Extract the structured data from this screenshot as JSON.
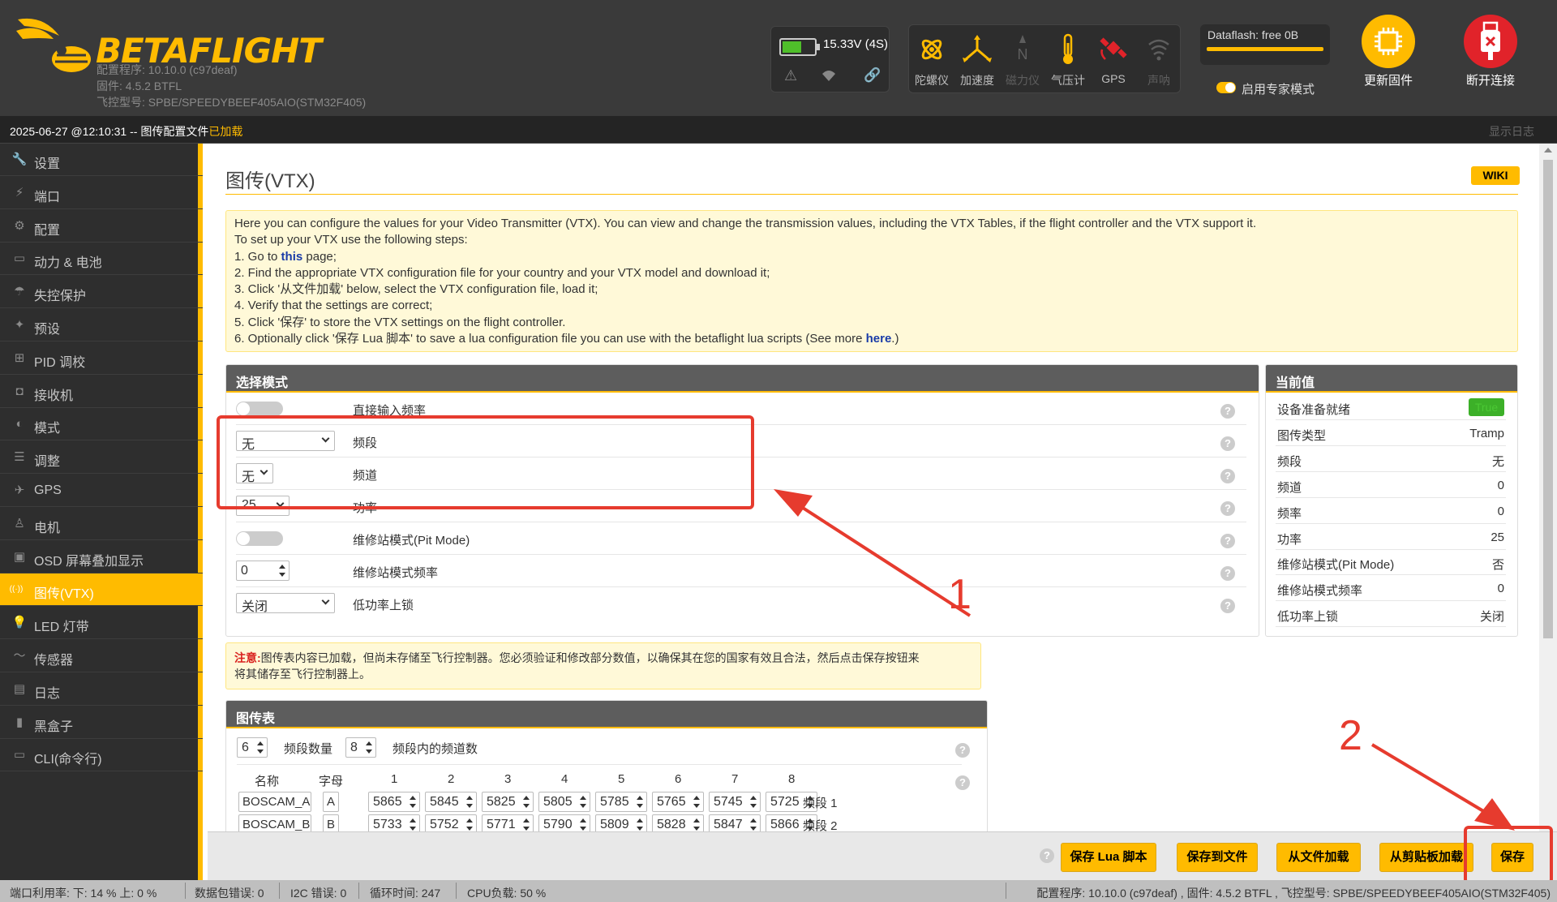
{
  "header": {
    "brand": "BETAFLIGHT",
    "configurator": "配置程序: 10.10.0 (c97deaf)",
    "firmware": "固件: 4.5.2 BTFL",
    "board": "飞控型号: SPBE/SPEEDYBEEF405AIO(STM32F405)",
    "battery": {
      "voltage": "15.33V (4S)",
      "level": 0.55,
      "fill_color": "#4fbf2a"
    },
    "sensors": [
      {
        "label": "陀螺仪",
        "icon": "gyro-icon",
        "active": true
      },
      {
        "label": "加速度",
        "icon": "accel-icon",
        "active": true
      },
      {
        "label": "磁力仪",
        "icon": "compass-icon",
        "active": false
      },
      {
        "label": "气压计",
        "icon": "baro-icon",
        "active": true
      },
      {
        "label": "GPS",
        "icon": "gps-icon",
        "active": true
      },
      {
        "label": "声呐",
        "icon": "sonar-icon",
        "active": false
      }
    ],
    "dataflash": "Dataflash: free 0B",
    "expert_mode": "启用专家模式",
    "update_firmware": "更新固件",
    "disconnect": "断开连接",
    "accent": "#ffbb00",
    "disconnect_color": "#e1232a"
  },
  "logbar": {
    "prefix": "2025-06-27 @12:10:31 -- 图传配置文件",
    "loaded": "已加载",
    "show_log": "显示日志"
  },
  "sidebar": {
    "items": [
      {
        "label": "设置",
        "icon": "wrench-icon",
        "active": false
      },
      {
        "label": "端口",
        "icon": "plug-icon",
        "active": false
      },
      {
        "label": "配置",
        "icon": "gear-icon",
        "active": false
      },
      {
        "label": "动力 & 电池",
        "icon": "battery-icon",
        "active": false
      },
      {
        "label": "失控保护",
        "icon": "parachute-icon",
        "active": false
      },
      {
        "label": "预设",
        "icon": "wand-icon",
        "active": false
      },
      {
        "label": "PID 调校",
        "icon": "sitemap-icon",
        "active": false
      },
      {
        "label": "接收机",
        "icon": "receiver-icon",
        "active": false
      },
      {
        "label": "模式",
        "icon": "toggle-icon",
        "active": false
      },
      {
        "label": "调整",
        "icon": "sliders-icon",
        "active": false
      },
      {
        "label": "GPS",
        "icon": "satellite-icon",
        "active": false
      },
      {
        "label": "电机",
        "icon": "motor-icon",
        "active": false
      },
      {
        "label": "OSD 屏幕叠加显示",
        "icon": "osd-icon",
        "active": false
      },
      {
        "label": "图传(VTX)",
        "icon": "broadcast-icon",
        "active": true
      },
      {
        "label": "LED 灯带",
        "icon": "led-icon",
        "active": false
      },
      {
        "label": "传感器",
        "icon": "pulse-icon",
        "active": false
      },
      {
        "label": "日志",
        "icon": "log-icon",
        "active": false
      },
      {
        "label": "黑盒子",
        "icon": "blackbox-icon",
        "active": false
      },
      {
        "label": "CLI(命令行)",
        "icon": "terminal-icon",
        "active": false
      }
    ]
  },
  "main": {
    "title": "图传(VTX)",
    "wiki": "WIKI",
    "note": {
      "l1": "Here you can configure the values for your Video Transmitter (VTX). You can view and change the transmission values, including the VTX Tables, if the flight controller and the VTX support it.",
      "l2": "To set up your VTX use the following steps:",
      "l3a": "1. Go to ",
      "l3link": "this",
      "l3b": " page;",
      "l4": "2. Find the appropriate VTX configuration file for your country and your VTX model and download it;",
      "l5": "3. Click '从文件加载' below, select the VTX configuration file, load it;",
      "l6": "4. Verify that the settings are correct;",
      "l7": "5. Click '保存' to store the VTX settings on the flight controller.",
      "l8a": "6. Optionally click '保存 Lua 脚本' to save a lua configuration file you can use with the betaflight lua scripts (See more ",
      "l8link": "here",
      "l8b": ".)"
    },
    "select_mode": {
      "title": "选择模式",
      "direct_freq": "直接输入频率",
      "band_label": "频段",
      "band_value": "无",
      "channel_label": "频道",
      "channel_value": "无",
      "power_label": "功率",
      "power_value": "25",
      "pit_label": "维修站模式(Pit Mode)",
      "pit_freq_label": "维修站模式频率",
      "pit_freq_value": "0",
      "low_power_label": "低功率上锁",
      "low_power_value": "关闭"
    },
    "current": {
      "title": "当前值",
      "rows": [
        {
          "label": "设备准备就绪",
          "value": "True"
        },
        {
          "label": "图传类型",
          "value": "Tramp"
        },
        {
          "label": "频段",
          "value": "无"
        },
        {
          "label": "频道",
          "value": "0"
        },
        {
          "label": "频率",
          "value": "0"
        },
        {
          "label": "功率",
          "value": "25"
        },
        {
          "label": "维修站模式(Pit Mode)",
          "value": "否"
        },
        {
          "label": "维修站模式频率",
          "value": "0"
        },
        {
          "label": "低功率上锁",
          "value": "关闭"
        }
      ]
    },
    "warning": {
      "prefix": "注意:",
      "text1": "图传表内容已加载，但尚未存储至飞行控制器。您必须验证和修改部分数值，以确保其在您的国家有效且合法，然后点击保存按钮来",
      "text2": "将其储存至飞行控制器上。"
    },
    "vtx_table": {
      "title": "图传表",
      "band_count": "6",
      "band_count_label": "频段数量",
      "channel_count": "8",
      "channel_count_label": "频段内的频道数",
      "col_name": "名称",
      "col_letter": "字母",
      "channel_headers": [
        "1",
        "2",
        "3",
        "4",
        "5",
        "6",
        "7",
        "8"
      ],
      "bands": [
        {
          "name": "BOSCAM_A",
          "letter": "A",
          "freqs": [
            "5865",
            "5845",
            "5825",
            "5805",
            "5785",
            "5765",
            "5745",
            "5725"
          ],
          "tag": "频段 1"
        },
        {
          "name": "BOSCAM_B",
          "letter": "B",
          "freqs": [
            "5733",
            "5752",
            "5771",
            "5790",
            "5809",
            "5828",
            "5847",
            "5866"
          ],
          "tag": "频段 2"
        }
      ]
    }
  },
  "actions": {
    "save_lua": "保存 Lua 脚本",
    "save_file": "保存到文件",
    "load_file": "从文件加载",
    "load_clipboard": "从剪贴板加载",
    "save": "保存"
  },
  "annotations": {
    "n1": "1",
    "n2": "2",
    "color": "#e63b2e"
  },
  "status": {
    "port_util": "端口利用率:   下: 14 % 上: 0 %",
    "packet_err": "数据包错误: 0",
    "i2c_err": "I2C 错误: 0",
    "cycle": "循环时间: 247",
    "cpu": "CPU负载: 50 %",
    "version": "配置程序: 10.10.0 (c97deaf) , 固件: 4.5.2 BTFL , 飞控型号: SPBE/SPEEDYBEEF405AIO(STM32F405)"
  }
}
